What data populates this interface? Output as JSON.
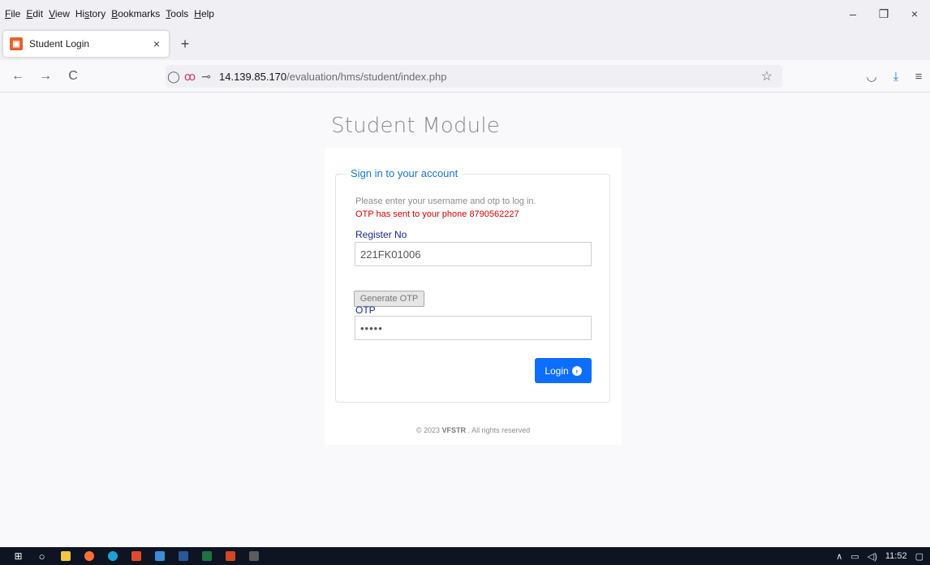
{
  "menu": [
    "File",
    "Edit",
    "View",
    "History",
    "Bookmarks",
    "Tools",
    "Help"
  ],
  "menu_access": [
    "F",
    "E",
    "V",
    "s",
    "B",
    "T",
    "H"
  ],
  "tab": {
    "title": "Student Login",
    "close": "×",
    "new_tab": "+"
  },
  "window_controls": {
    "minimize": "–",
    "restore": "❐",
    "close": "×"
  },
  "nav": {
    "back": "←",
    "forward": "→",
    "reload": "C"
  },
  "url": {
    "host": "14.139.85.170",
    "path": "/evaluation/hms/student/index.php"
  },
  "page": {
    "title": "Student Module",
    "legend": "Sign in to your account",
    "instruction": "Please enter your username and otp to log in.",
    "otp_message": "OTP has sent to your phone 8790562227",
    "register_label": "Register No",
    "register_value": "221FK01006",
    "generate_label": "Generate OTP",
    "otp_label": "OTP",
    "otp_value": "•••••",
    "login_label": "Login",
    "footer_prefix": "© 2023",
    "footer_brand": "VFSTR",
    "footer_suffix": ". All rights reserved"
  },
  "taskbar": {
    "time": "11:52"
  },
  "colors": {
    "link": "#1876c9",
    "error": "#d60000",
    "primary": "#0d6efd",
    "label": "#1a2a8b",
    "taskbar": "#0e1421"
  }
}
